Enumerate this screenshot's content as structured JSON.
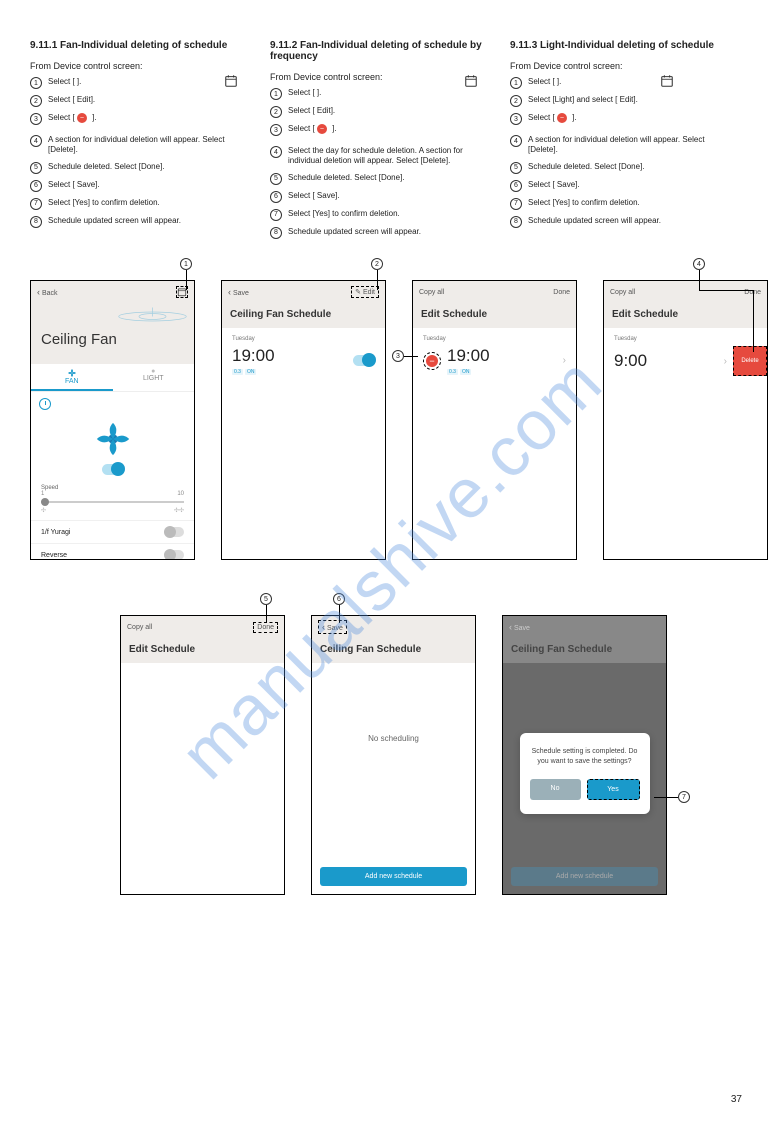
{
  "watermark": "manualshive.com",
  "colA": {
    "title": "9.11.1 Fan-Individual deleting of schedule",
    "sub": "From Device control screen:",
    "steps": [
      "Select [      ].",
      "Select [  Edit].",
      "Select [     ].",
      "A section for individual deletion will appear. Select [Delete].",
      "Schedule deleted. Select [Done].",
      "Select [  Save].",
      "Select [Yes] to confirm deletion.",
      "Schedule updated screen will appear."
    ]
  },
  "colB": {
    "title": "9.11.2 Fan-Individual deleting of schedule by frequency",
    "sub": "From Device control screen:",
    "steps": [
      "Select [      ].",
      "Select [  Edit].",
      "Select [     ].",
      "Select the day for schedule deletion. A section for individual deletion will appear. Select [Delete].",
      "Schedule deleted. Select [Done].",
      "Select [  Save].",
      "Select [Yes] to confirm deletion.",
      "Schedule updated screen will appear."
    ]
  },
  "colC": {
    "title": "9.11.3 Light-Individual deleting of schedule",
    "sub": "From Device control screen:",
    "steps": [
      "Select [      ].",
      "Select [Light] and select [  Edit].",
      "Select [     ].",
      "A section for individual deletion will appear. Select [Delete].",
      "Schedule deleted. Select [Done].",
      "Select [  Save].",
      "Select [Yes] to confirm deletion.",
      "Schedule updated screen will appear."
    ]
  },
  "phone1": {
    "back": "Back",
    "title": "Ceiling Fan",
    "tab_fan": "FAN",
    "tab_light": "LIGHT",
    "speed_label": "Speed",
    "speed_min": "1",
    "speed_max": "10",
    "yuragi": "1/f Yuragi",
    "reverse": "Reverse"
  },
  "phone2": {
    "save": "Save",
    "edit": "Edit",
    "title": "Ceiling Fan Schedule",
    "day": "Tuesday",
    "time": "19:00",
    "tag1": "0.3",
    "tag2": "ON"
  },
  "phone3": {
    "copy": "Copy all",
    "done": "Done",
    "title": "Edit Schedule",
    "day": "Tuesday",
    "time": "19:00",
    "tag1": "0.3",
    "tag2": "ON"
  },
  "phone4": {
    "copy": "Copy all",
    "done": "Done",
    "title": "Edit Schedule",
    "day": "Tuesday",
    "time": "9:00",
    "delete": "Delete"
  },
  "phone5": {
    "copy": "Copy all",
    "done": "Done",
    "title": "Edit Schedule"
  },
  "phone6": {
    "save": "Save",
    "title": "Ceiling Fan Schedule",
    "empty": "No scheduling",
    "add": "Add new schedule"
  },
  "phone7": {
    "save": "Save",
    "title": "Ceiling Fan Schedule",
    "modal_text": "Schedule setting is completed. Do you want to save the settings?",
    "no": "No",
    "yes": "Yes",
    "add": "Add new schedule"
  },
  "page_num": "37"
}
